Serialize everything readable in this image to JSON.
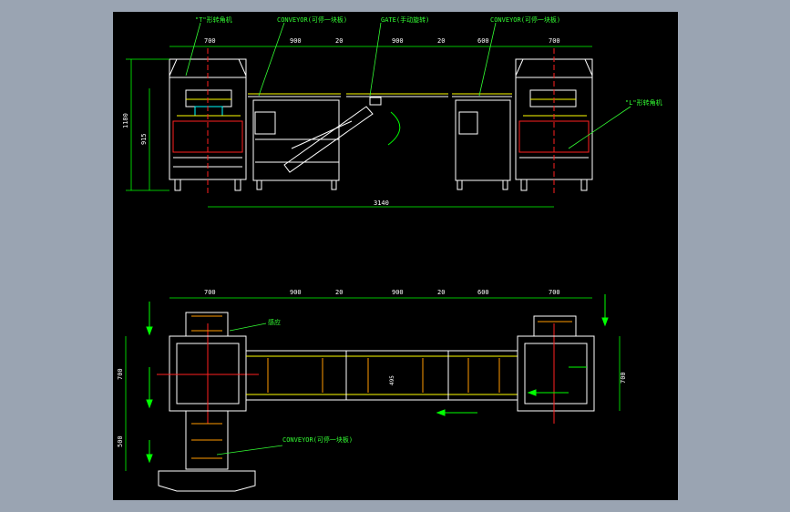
{
  "colors": {
    "frame": "#ffffff",
    "dim": "#00ff00",
    "center": "#ff2020",
    "label": "#33ff33",
    "yellow": "#ffff00",
    "cyan": "#00ffff",
    "orange": "#ff9a00",
    "blue": "#3070ff",
    "bg": "#000000",
    "outer": "#9aa4b2"
  },
  "labels": {
    "t_machine": "\"T\"形转角机",
    "conveyor_1": "CONVEYOR(可停一块板)",
    "gate": "GATE(手动旋转)",
    "conveyor_2": "CONVEYOR(可停一块板)",
    "l_machine": "\"L\"形转角机",
    "sensor": "感应",
    "conveyor_3": "CONVEYOR(可停一块板)"
  },
  "dims": {
    "top": [
      "700",
      "900",
      "20",
      "900",
      "20",
      "600",
      "700"
    ],
    "total": "3140",
    "height_total": "1180",
    "height_work": "915",
    "bottom": [
      "700",
      "900",
      "20",
      "900",
      "20",
      "600",
      "700"
    ],
    "left_a": "700",
    "left_b": "500",
    "right_a": "700",
    "mid": "495"
  }
}
